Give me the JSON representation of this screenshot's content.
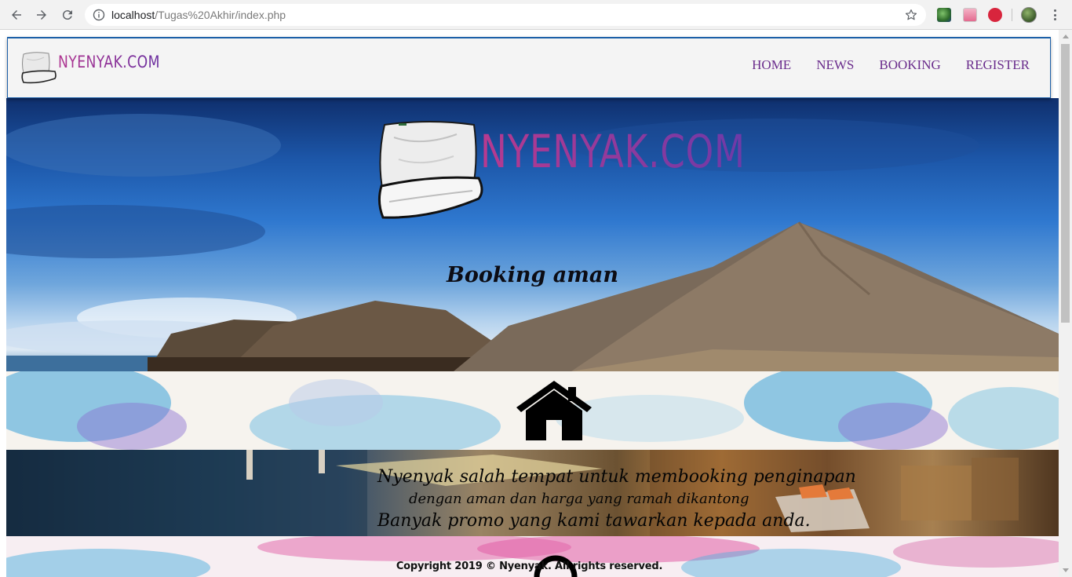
{
  "browser": {
    "url_host": "localhost",
    "url_path": "/Tugas%20Akhir/index.php"
  },
  "site": {
    "logo_text": "NYENYAK.COM",
    "nav": [
      {
        "label": "HOME"
      },
      {
        "label": "NEWS"
      },
      {
        "label": "BOOKING"
      },
      {
        "label": "REGISTER"
      }
    ]
  },
  "hero": {
    "logo_text": "NYENYAK.COM",
    "tagline": "Booking aman"
  },
  "promo": {
    "line1": "Nyenyak salah tempat untuk membooking penginapan",
    "line2": "dengan aman dan harga yang ramah dikantong",
    "line3": "Banyak promo yang kami tawarkan kepada anda."
  },
  "footer": {
    "copyright": "Copyright 2019 © Nyenyak. All rights reserved."
  },
  "colors": {
    "brand_pink": "#b0338f",
    "brand_purple": "#6a2fa0",
    "nav_text": "#6a2c8c",
    "header_border": "#1b5fa8"
  },
  "icons": [
    "back-icon",
    "forward-icon",
    "reload-icon",
    "info-icon",
    "bookmark-star-icon",
    "extension-icon",
    "profile-avatar",
    "menu-kebab-icon",
    "pillow-logo-icon",
    "home-icon"
  ]
}
